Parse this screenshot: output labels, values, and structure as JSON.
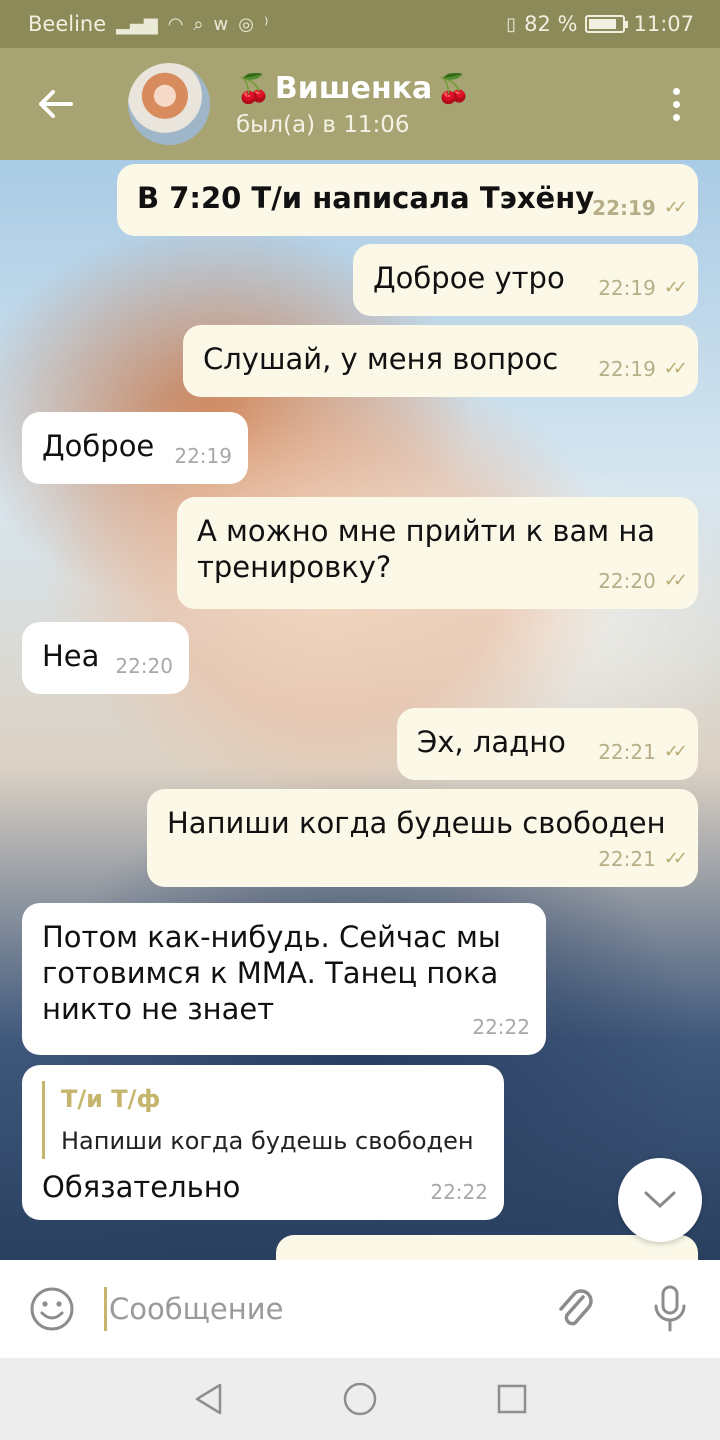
{
  "status_bar": {
    "carrier": "Beeline",
    "battery_percent": "82 %",
    "battery_level": 0.82,
    "time": "11:07"
  },
  "header": {
    "title": "Вишенка",
    "title_decoration": "cherry-emoji",
    "subtitle": "был(а) в 11:06"
  },
  "messages": [
    {
      "text": "В 7:20 Т/и написала Тэхёну",
      "time": "22:19",
      "outgoing": true
    },
    {
      "text": "Доброе утро",
      "time": "22:19",
      "outgoing": true
    },
    {
      "text": "Слушай, у меня вопрос",
      "time": "22:19",
      "outgoing": true
    },
    {
      "text": "Доброе",
      "time": "22:19",
      "outgoing": false
    },
    {
      "text": "А можно мне прийти к вам на тренировку?",
      "time": "22:20",
      "outgoing": true
    },
    {
      "text": "Неа",
      "time": "22:20",
      "outgoing": false
    },
    {
      "text": "Эх, ладно",
      "time": "22:21",
      "outgoing": true
    },
    {
      "text": "Напиши когда будешь свободен",
      "time": "22:21",
      "outgoing": true
    },
    {
      "text": "Потом как-нибудь. Сейчас мы готовимся к ММА. Танец пока никто не знает",
      "time": "22:22",
      "outgoing": false
    },
    {
      "text": "Обязательно",
      "time": "22:22",
      "outgoing": false,
      "reply_to": {
        "name": "Т/и Т/ф",
        "text": "Напиши когда будешь свободен"
      }
    }
  ],
  "input": {
    "placeholder": "Сообщение"
  },
  "colors": {
    "header": "#a7a372",
    "status_bar": "#8d8a5a",
    "outgoing_bubble": "#fbf8e8",
    "incoming_bubble": "#ffffff",
    "accent": "#c6b56c"
  },
  "icons": [
    "back-arrow-icon",
    "more-vert-icon",
    "emoji-icon",
    "attach-icon",
    "mic-icon",
    "scroll-down-icon",
    "nav-back-icon",
    "nav-home-icon",
    "nav-recents-icon"
  ]
}
